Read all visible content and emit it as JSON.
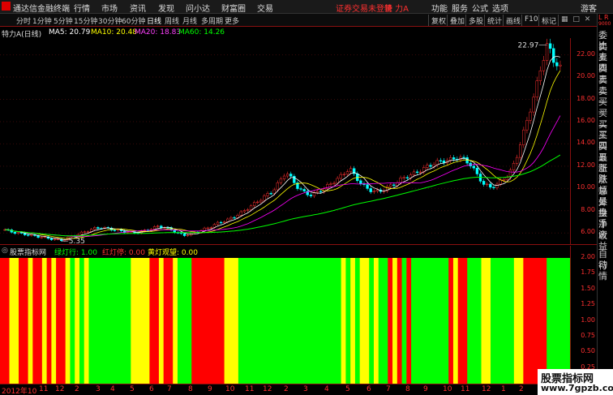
{
  "app": {
    "brand": "通达信金融终端",
    "menus": [
      "行情",
      "市场",
      "资讯",
      "发现",
      "问小达",
      "财富圈",
      "交易"
    ],
    "status": "证券交易未登录",
    "stock_name": "特 力A",
    "right_menus": [
      "功能",
      "服务",
      "公式",
      "选项"
    ],
    "user": "游客"
  },
  "toolbar": {
    "periods": [
      "分时",
      "1分钟",
      "5分钟",
      "15分钟",
      "30分钟",
      "60分钟",
      "日线",
      "周线",
      "月线",
      "多周期",
      "更多"
    ],
    "active_period": "日线",
    "buttons": [
      "复权",
      "叠加",
      "多股",
      "统计",
      "画线",
      "F10",
      "标记"
    ]
  },
  "ma_line": {
    "title": "特力A(日线)",
    "ma5": "MA5: 20.79",
    "ma10": "MA10: 20.48",
    "ma20": "MA20: 18.83",
    "ma60": "MA60: 14.26",
    "colors": {
      "ma5": "#ffffff",
      "ma10": "#ffff00",
      "ma20": "#ff00ff",
      "ma60": "#00ff00"
    }
  },
  "indicator_line": {
    "title": "股票指标网",
    "green": "绿灯行: 1.00",
    "red": "红灯停: 0.00",
    "yellow": "黄灯观望: 0.00"
  },
  "right_side": [
    "委比",
    "卖五",
    "卖四",
    "卖三",
    "卖二",
    "卖一",
    "买一",
    "买二",
    "买三",
    "买四",
    "买五",
    "最新",
    "涨跌",
    "涨幅",
    "总量",
    "外盘",
    "换手",
    "净资",
    "收益",
    "自动",
    "行情"
  ],
  "right_top": {
    "letters": "L R",
    "small": "9000"
  },
  "watermark": {
    "cn": "股票指标网",
    "url": "www.7gpzb.com"
  },
  "chart_data": [
    {
      "type": "candlestick",
      "title": "特力A(日线)",
      "price_labels": [
        "22.00",
        "20.00",
        "18.00",
        "16.00",
        "14.00",
        "12.00",
        "10.00",
        "8.00",
        "6.00"
      ],
      "ylim": [
        5.0,
        23.5
      ],
      "annotations": {
        "high": "22.97",
        "low": "5.35"
      },
      "series": [
        {
          "name": "MA5",
          "color": "#ffffff"
        },
        {
          "name": "MA10",
          "color": "#ffff00"
        },
        {
          "name": "MA20",
          "color": "#ff00ff"
        },
        {
          "name": "MA60",
          "color": "#00ff00"
        }
      ],
      "x_labels": [
        "2012年10",
        "11",
        "12",
        "2",
        "3",
        "4",
        "5",
        "6",
        "7",
        "8",
        "9",
        "10",
        "11",
        "12",
        "2",
        "3",
        "4",
        "5",
        "6",
        "7",
        "8",
        "9",
        "10",
        "11",
        "12",
        "1",
        "2",
        "3"
      ],
      "price_path": [
        6.3,
        6.1,
        6.0,
        5.9,
        5.8,
        5.7,
        5.6,
        5.5,
        5.4,
        5.35,
        5.6,
        5.8,
        6.0,
        6.2,
        6.4,
        6.5,
        6.4,
        6.3,
        6.2,
        6.1,
        6.0,
        6.1,
        6.2,
        6.4,
        6.6,
        6.5,
        6.3,
        6.0,
        5.8,
        5.9,
        6.1,
        6.3,
        6.5,
        6.8,
        7.0,
        7.2,
        7.5,
        7.8,
        8.2,
        8.6,
        9.0,
        9.4,
        9.8,
        10.6,
        11.5,
        10.8,
        10.0,
        9.6,
        9.4,
        9.7,
        10.0,
        10.4,
        10.8,
        11.3,
        11.8,
        11.0,
        10.3,
        9.9,
        9.7,
        9.8,
        10.1,
        10.4,
        10.8,
        11.1,
        11.3,
        11.6,
        11.9,
        12.2,
        12.4,
        12.5,
        12.6,
        12.8,
        12.6,
        12.1,
        11.2,
        10.4,
        10.1,
        10.3,
        10.8,
        11.3,
        12.5,
        14.5,
        16.5,
        18.5,
        21.0,
        22.97,
        21.5,
        20.8
      ]
    },
    {
      "type": "bar",
      "title": "股票指标网",
      "ylim": [
        0,
        2.0
      ],
      "tick_labels": [
        "2.00",
        "1.75",
        "1.50",
        "1.25",
        "1.00",
        "0.75",
        "0.50",
        "0.25"
      ],
      "series": [
        {
          "name": "绿灯行",
          "color": "#00ff00",
          "value": 1.0
        },
        {
          "name": "红灯停",
          "color": "#ff0000",
          "value": 0.0
        },
        {
          "name": "黄灯观望",
          "color": "#ffff00",
          "value": 0.0
        }
      ],
      "segments": [
        [
          "R",
          2
        ],
        [
          "Y",
          2
        ],
        [
          "R",
          2
        ],
        [
          "Y",
          1
        ],
        [
          "R",
          2
        ],
        [
          "Y",
          1
        ],
        [
          "R",
          1
        ],
        [
          "Y",
          1
        ],
        [
          "R",
          2
        ],
        [
          "Y",
          1
        ],
        [
          "G",
          1
        ],
        [
          "Y",
          1
        ],
        [
          "G",
          1
        ],
        [
          "Y",
          1
        ],
        [
          "G",
          9
        ],
        [
          "Y",
          4
        ],
        [
          "R",
          2
        ],
        [
          "Y",
          1
        ],
        [
          "R",
          2
        ],
        [
          "Y",
          1
        ],
        [
          "G",
          3
        ],
        [
          "R",
          7
        ],
        [
          "Y",
          3
        ],
        [
          "G",
          22
        ],
        [
          "Y",
          1
        ],
        [
          "G",
          1
        ],
        [
          "Y",
          1
        ],
        [
          "G",
          1
        ],
        [
          "Y",
          2
        ],
        [
          "G",
          1
        ],
        [
          "Y",
          1
        ],
        [
          "G",
          2
        ],
        [
          "R",
          1
        ],
        [
          "Y",
          1
        ],
        [
          "R",
          1
        ],
        [
          "G",
          1
        ],
        [
          "R",
          1
        ],
        [
          "G",
          8
        ],
        [
          "R",
          1
        ],
        [
          "Y",
          1
        ],
        [
          "R",
          2
        ],
        [
          "G",
          3
        ],
        [
          "Y",
          2
        ],
        [
          "G",
          5
        ],
        [
          "Y",
          2
        ],
        [
          "R",
          5
        ],
        [
          "G",
          5
        ]
      ]
    }
  ]
}
